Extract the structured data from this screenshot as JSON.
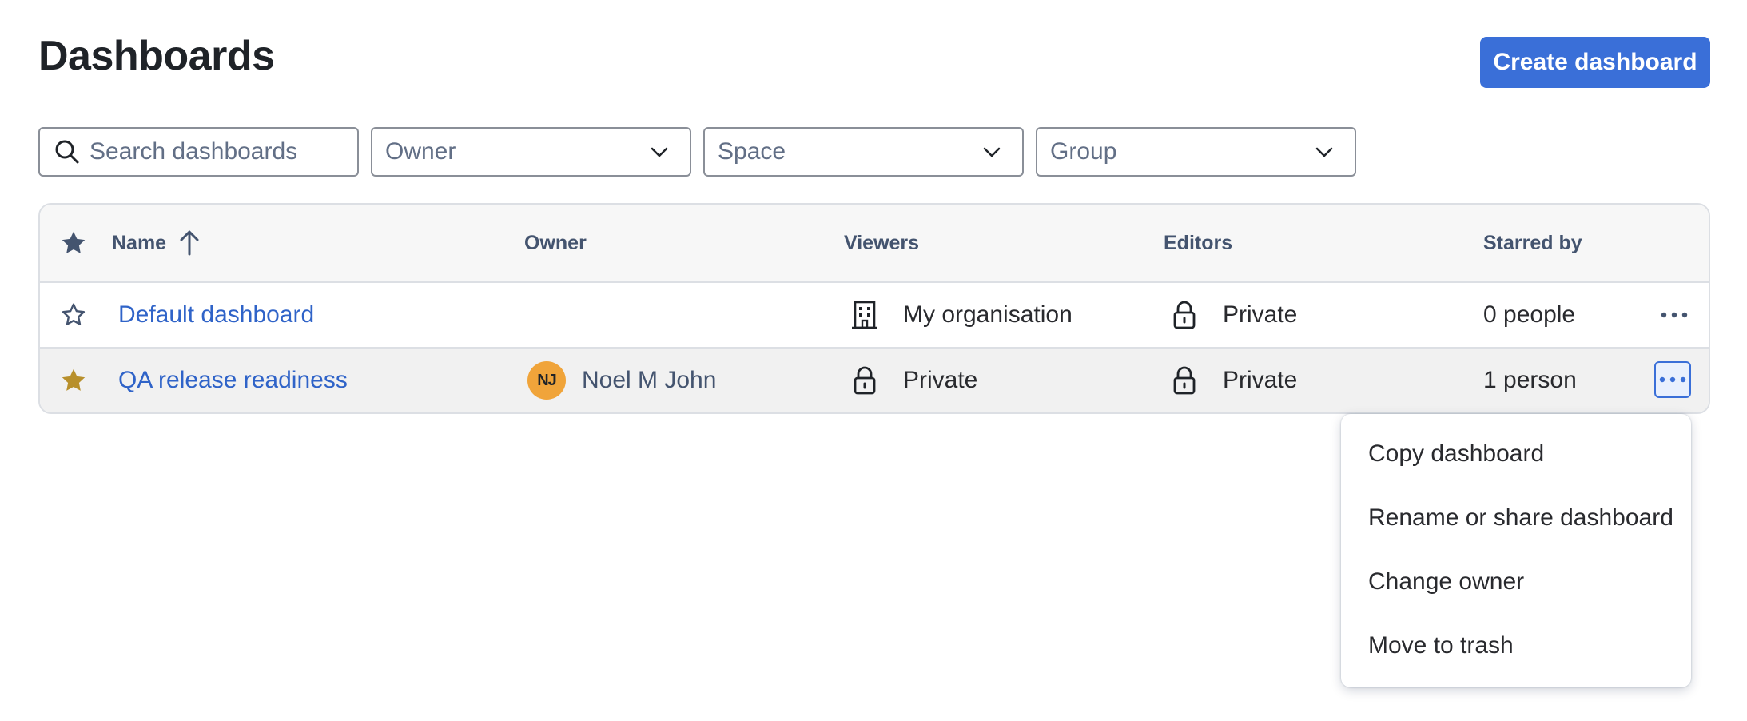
{
  "header": {
    "title": "Dashboards",
    "create_button": "Create dashboard"
  },
  "filters": {
    "search_placeholder": "Search dashboards",
    "owner": "Owner",
    "space": "Space",
    "group": "Group"
  },
  "table": {
    "columns": {
      "name": "Name",
      "owner": "Owner",
      "viewers": "Viewers",
      "editors": "Editors",
      "starred_by": "Starred by"
    },
    "sort": "ascending",
    "rows": [
      {
        "starred": false,
        "name": "Default dashboard",
        "owner": "",
        "owner_initials": "",
        "viewers": "My organisation",
        "viewers_icon": "building-icon",
        "editors": "Private",
        "editors_icon": "lock-icon",
        "starred_by": "0 people"
      },
      {
        "starred": true,
        "name": "QA release readiness",
        "owner": "Noel M John",
        "owner_initials": "NJ",
        "viewers": "Private",
        "viewers_icon": "lock-icon",
        "editors": "Private",
        "editors_icon": "lock-icon",
        "starred_by": "1 person"
      }
    ]
  },
  "menu": {
    "items": [
      "Copy dashboard",
      "Rename or share dashboard",
      "Change owner",
      "Move to trash"
    ]
  },
  "colors": {
    "accent": "#3a6fd8",
    "link": "#2f63c8",
    "star_filled": "#b8902c",
    "avatar": "#f0a43a"
  }
}
